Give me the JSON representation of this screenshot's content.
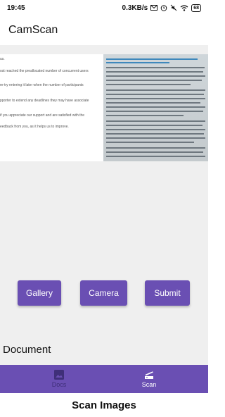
{
  "status_bar": {
    "time": "19:45",
    "network_speed": "0.3KB/s",
    "battery": "68",
    "icons": [
      "mail-icon",
      "alarm-icon",
      "mute-icon",
      "wifi-icon",
      "battery-icon"
    ]
  },
  "app_bar": {
    "title": "CamScan"
  },
  "preview": {
    "left_text_lines": [
      "us.",
      "ost reached the preallocated number of concurrent users",
      "re-try entering it later when the number of participants",
      "pporter to extend any deadlines they may have associate",
      "if you appreciate our support and are satisfied with the",
      "eedback from you, as it helps us to improve."
    ]
  },
  "actions": {
    "gallery_label": "Gallery",
    "camera_label": "Camera",
    "submit_label": "Submit"
  },
  "section_label": "Document",
  "bottom_nav": {
    "items": [
      {
        "label": "Docs",
        "icon": "image-icon",
        "active": false
      },
      {
        "label": "Scan",
        "icon": "scanner-icon",
        "active": true
      }
    ]
  },
  "caption": "Scan Images",
  "colors": {
    "accent": "#6a4fb3",
    "nav_inactive": "#3f2f79",
    "background": "#efefef"
  }
}
